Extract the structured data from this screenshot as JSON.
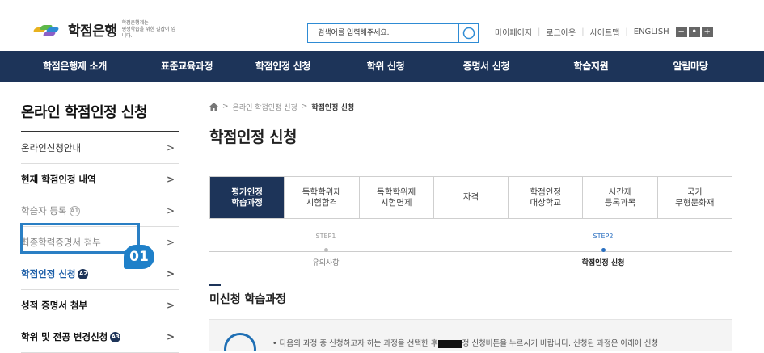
{
  "header": {
    "logo_title": "학점은행",
    "logo_sub_line1": "학점은행제는",
    "logo_sub_line2": "평생학습을 위한 길잡이 입니다.",
    "search_placeholder": "검색어를 입력해주세요.",
    "util_links": [
      "마이페이지",
      "로그아웃",
      "사이트맵",
      "ENGLISH"
    ],
    "zoom_buttons": [
      "−",
      "•",
      "+"
    ]
  },
  "nav": {
    "items": [
      "학점은행제 소개",
      "표준교육과정",
      "학점인정 신청",
      "학위 신청",
      "증명서 신청",
      "학습지원",
      "알림마당"
    ]
  },
  "sidebar": {
    "title": "온라인 학점인정 신청",
    "items": [
      {
        "label": "온라인신청안내",
        "badge": ""
      },
      {
        "label": "현재 학점인정 내역",
        "badge": ""
      },
      {
        "label": "학습자 등록",
        "badge": "A1"
      },
      {
        "label": "최종학력증명서 첨부",
        "badge": ""
      },
      {
        "label": "학점인정 신청",
        "badge": "A2"
      },
      {
        "label": "성적 증명서 첨부",
        "badge": ""
      },
      {
        "label": "학위 및 전공 변경신청",
        "badge": "A3"
      }
    ],
    "chevron": ">",
    "callout_number": "01"
  },
  "breadcrumb": {
    "home_icon": "home-icon",
    "items": [
      "온라인 학점인정 신청",
      "학점인정 신청"
    ],
    "separator": ">"
  },
  "page_title": "학점인정 신청",
  "tabs": [
    {
      "line1": "평가인정",
      "line2": "학습과정",
      "active": true
    },
    {
      "line1": "독학학위제",
      "line2": "시험합격",
      "active": false
    },
    {
      "line1": "독학학위제",
      "line2": "시험면제",
      "active": false
    },
    {
      "line1": "자격",
      "line2": "",
      "active": false
    },
    {
      "line1": "학점인정",
      "line2": "대상학교",
      "active": false
    },
    {
      "line1": "시간제",
      "line2": "등록과목",
      "active": false
    },
    {
      "line1": "국가",
      "line2": "무형문화재",
      "active": false
    }
  ],
  "steps": [
    {
      "label": "STEP1",
      "name": "유의사항",
      "active": false
    },
    {
      "label": "STEP2",
      "name": "학점인정 신청",
      "active": true
    }
  ],
  "section_title": "미신청 학습과정",
  "notice": {
    "text_before": "• 다음의 과정 중 신청하고자 하는 과정을 선택한 후",
    "text_after": "정 신청버튼을 누르시기 바랍니다. 신청된 과정은 아래에 신청"
  },
  "colors": {
    "nav_bg": "#1d3459",
    "accent_blue": "#1f80c9",
    "active_link": "#1d5fa8"
  }
}
